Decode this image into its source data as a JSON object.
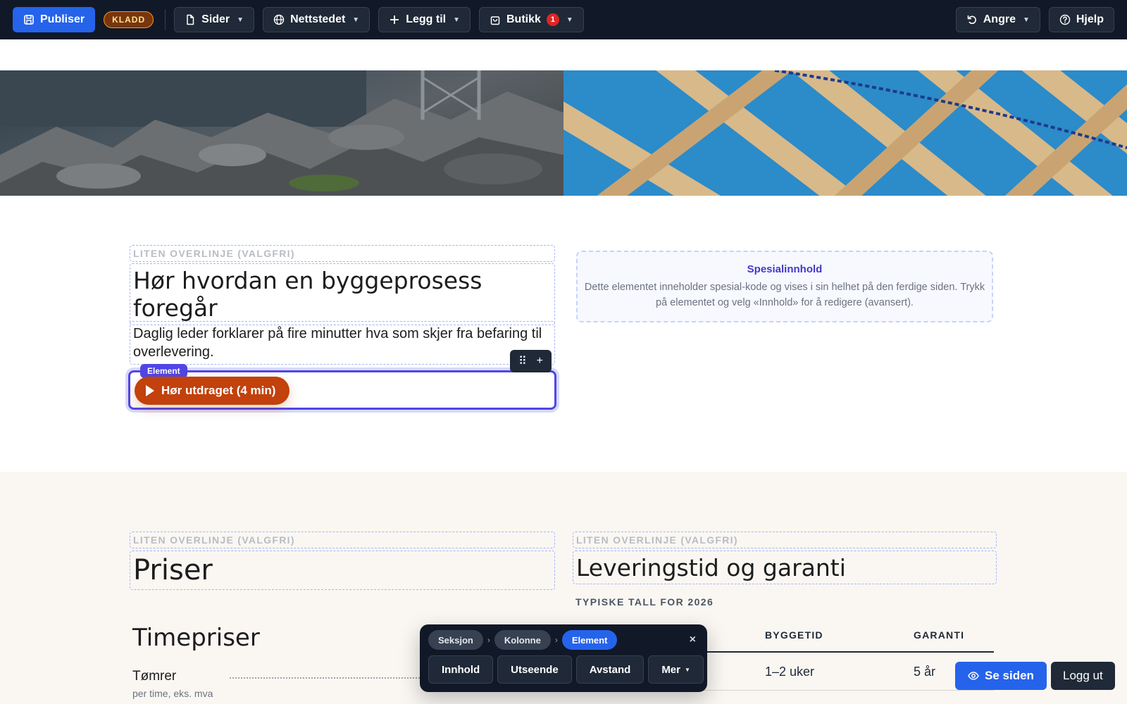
{
  "toolbar": {
    "publish_label": "Publiser",
    "draft_badge": "KLADD",
    "pages_label": "Sider",
    "site_label": "Nettstedet",
    "add_label": "Legg til",
    "shop_label": "Butikk",
    "shop_count": "1",
    "undo_label": "Angre",
    "help_label": "Hjelp"
  },
  "section1": {
    "overline": "LITEN OVERLINJE (VALGFRI)",
    "title": "Hør hvordan en byggeprosess foregår",
    "lead": "Daglig leder forklarer på fire minutter hva som skjer fra befaring til overlevering.",
    "selected_tag": "Element",
    "play_label": "Hør utdraget (4 min)",
    "special": {
      "title": "Spesialinnhold",
      "body": "Dette elementet inneholder spesial-kode og vises i sin helhet på den ferdige siden. Trykk på elementet og velg «Innhold» for å redigere (avansert)."
    }
  },
  "section2": {
    "left": {
      "overline": "LITEN OVERLINJE (VALGFRI)",
      "title": "Priser",
      "subtitle": "Timepriser",
      "items": [
        {
          "label": "Tømrer",
          "sub": "per time, eks. mva"
        }
      ]
    },
    "right": {
      "overline": "LITEN OVERLINJE (VALGFRI)",
      "title": "Leveringstid og garanti",
      "subhead": "TYPISKE TALL FOR 2026",
      "columns": [
        "BYGGETID",
        "GARANTI"
      ],
      "rows": [
        {
          "build": "1–2 uker",
          "warranty": "5 år"
        }
      ]
    }
  },
  "editor_bar": {
    "crumbs": [
      "Seksjon",
      "Kolonne",
      "Element"
    ],
    "actions": [
      "Innhold",
      "Utseende",
      "Avstand",
      "Mer"
    ],
    "close": "×"
  },
  "footer_buttons": {
    "view_label": "Se siden",
    "logout_label": "Logg ut"
  },
  "colors": {
    "toolbar_bg": "#111827",
    "accent": "#2563eb",
    "selection": "#4f46e5",
    "play_button": "#c2410c",
    "section2_bg": "#faf7f2"
  }
}
